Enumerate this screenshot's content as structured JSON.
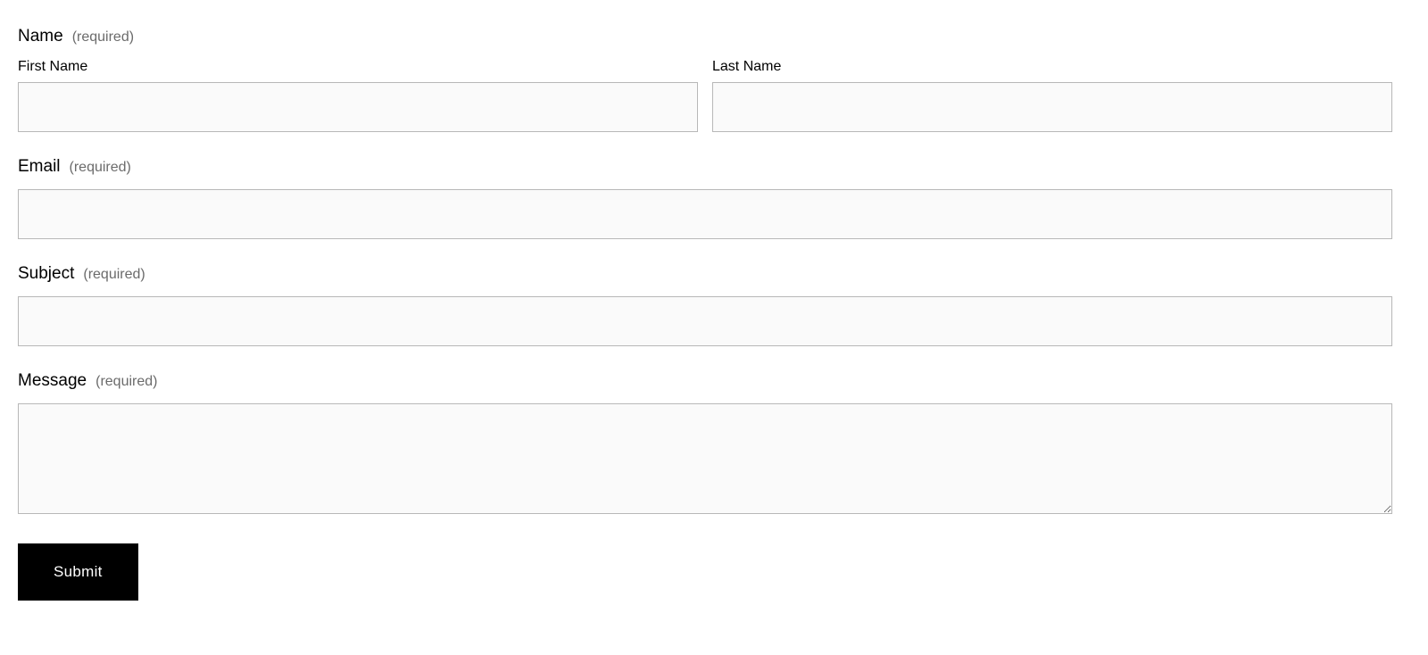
{
  "form": {
    "name": {
      "label": "Name",
      "required_text": "(required)",
      "first": {
        "label": "First Name",
        "value": ""
      },
      "last": {
        "label": "Last Name",
        "value": ""
      }
    },
    "email": {
      "label": "Email",
      "required_text": "(required)",
      "value": ""
    },
    "subject": {
      "label": "Subject",
      "required_text": "(required)",
      "value": ""
    },
    "message": {
      "label": "Message",
      "required_text": "(required)",
      "value": ""
    },
    "submit_label": "Submit"
  }
}
